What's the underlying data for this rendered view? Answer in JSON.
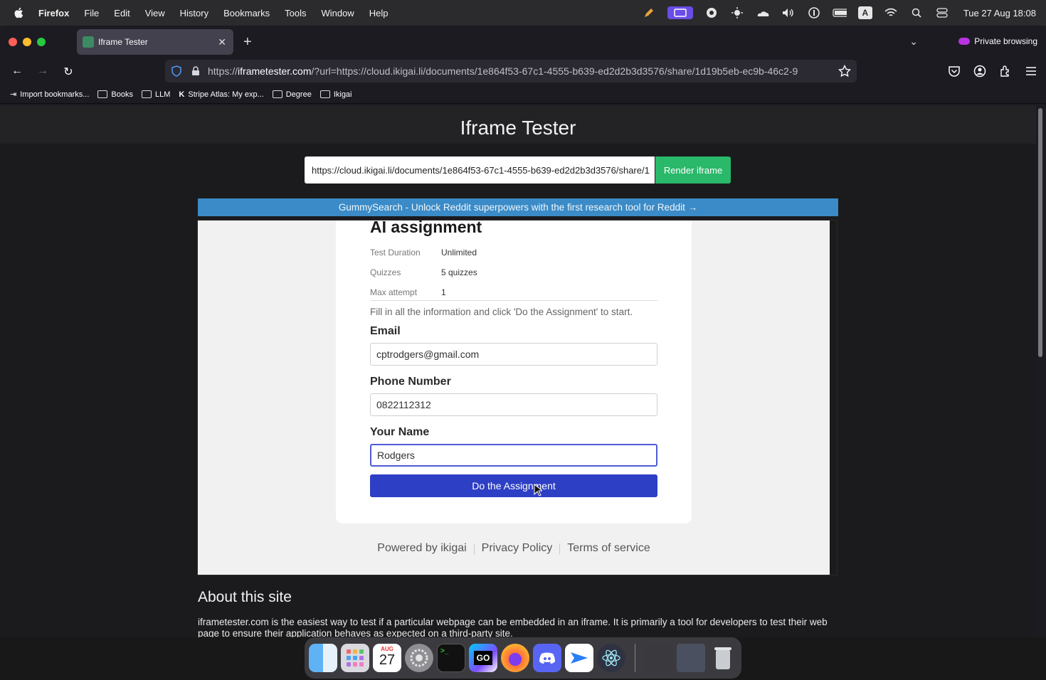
{
  "menubar": {
    "app": "Firefox",
    "items": [
      "File",
      "Edit",
      "View",
      "History",
      "Bookmarks",
      "Tools",
      "Window",
      "Help"
    ],
    "clock": "Tue 27 Aug  18:08",
    "icons": [
      "pen-icon",
      "screen-share-icon",
      "record-icon",
      "brightness-icon",
      "cloud-icon",
      "volume-icon",
      "1password-icon",
      "battery-icon",
      "input-source-icon",
      "wifi-icon",
      "spotlight-icon",
      "control-center-icon"
    ],
    "input_source": "A"
  },
  "browser": {
    "tab_title": "Iframe Tester",
    "private_label": "Private browsing",
    "url_host": "iframetester.com",
    "url_prefix": "https://",
    "url_rest": "/?url=https://cloud.ikigai.li/documents/1e864f53-67c1-4555-b639-ed2d2b3d3576/share/1d19b5eb-ec9b-46c2-9",
    "bookmarks": [
      {
        "label": "Import bookmarks...",
        "icon": "import-icon"
      },
      {
        "label": "Books",
        "icon": "folder-icon"
      },
      {
        "label": "LLM",
        "icon": "folder-icon"
      },
      {
        "label": "Stripe Atlas: My exp...",
        "icon": "k-icon"
      },
      {
        "label": "Degree",
        "icon": "folder-icon"
      },
      {
        "label": "Ikigai",
        "icon": "folder-icon"
      }
    ]
  },
  "page": {
    "title": "Iframe Tester",
    "url_input_value": "https://cloud.ikigai.li/documents/1e864f53-67c1-4555-b639-ed2d2b3d3576/share/1",
    "render_button": "Render iframe",
    "banner": "GummySearch - Unlock Reddit superpowers with the first research tool for Reddit →",
    "about_heading": "About this site",
    "about_text": "iframetester.com is the easiest way to test if a particular webpage can be embedded in an iframe. It is primarily a tool for developers to test their web page to ensure their application behaves as expected on a third-party site."
  },
  "assignment": {
    "title": "AI assignment",
    "meta": [
      {
        "label": "Test Duration",
        "value": "Unlimited"
      },
      {
        "label": "Quizzes",
        "value": "5 quizzes"
      },
      {
        "label": "Max attempt",
        "value": "1"
      }
    ],
    "instructions": "Fill in all the information and click 'Do the Assignment' to start.",
    "email_label": "Email",
    "email_value": "cptrodgers@gmail.com",
    "phone_label": "Phone Number",
    "phone_value": "0822112312",
    "name_label": "Your Name",
    "name_value": "Rodgers",
    "submit_label": "Do the Assignment",
    "footer": [
      "Powered by ikigai",
      "Privacy Policy",
      "Terms of service"
    ]
  },
  "dock": {
    "apps": [
      "finder",
      "launchpad",
      "calendar",
      "system-settings",
      "terminal",
      "goland",
      "firefox",
      "discord",
      "mail-spark",
      "electron",
      "preview-window",
      "screenshot-window",
      "trash"
    ],
    "calendar_month": "AUG",
    "calendar_day": "27",
    "goland_text": "GO"
  },
  "colors": {
    "accent_green": "#2ab86b",
    "banner_blue": "#3a8bc7",
    "submit_blue": "#2d3fc4",
    "private_purple": "#b833e1"
  }
}
